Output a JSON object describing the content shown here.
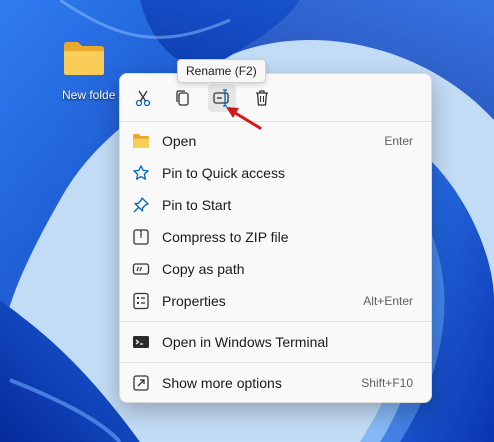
{
  "desktop": {
    "folder_label": "New folde"
  },
  "tooltip": {
    "text": "Rename (F2)"
  },
  "toolbar": {
    "buttons": [
      {
        "name": "cut",
        "icon": "scissors-icon"
      },
      {
        "name": "copy",
        "icon": "copy-icon"
      },
      {
        "name": "rename",
        "icon": "rename-icon"
      },
      {
        "name": "delete",
        "icon": "trash-icon"
      }
    ]
  },
  "menu": {
    "items": [
      {
        "label": "Open",
        "shortcut": "Enter",
        "icon": "folder-icon"
      },
      {
        "label": "Pin to Quick access",
        "shortcut": "",
        "icon": "star-icon"
      },
      {
        "label": "Pin to Start",
        "shortcut": "",
        "icon": "pin-icon"
      },
      {
        "label": "Compress to ZIP file",
        "shortcut": "",
        "icon": "zip-file-icon"
      },
      {
        "label": "Copy as path",
        "shortcut": "",
        "icon": "path-icon"
      },
      {
        "label": "Properties",
        "shortcut": "Alt+Enter",
        "icon": "properties-icon"
      },
      {
        "label": "Open in Windows Terminal",
        "shortcut": "",
        "icon": "terminal-icon"
      },
      {
        "label": "Show more options",
        "shortcut": "Shift+F10",
        "icon": "more-options-icon"
      }
    ]
  },
  "colors": {
    "accent": "#0067c0",
    "annotation_arrow": "#d11a1a",
    "wallpaper_dark": "#0a3fbf",
    "wallpaper_light": "#b5d4f2"
  }
}
